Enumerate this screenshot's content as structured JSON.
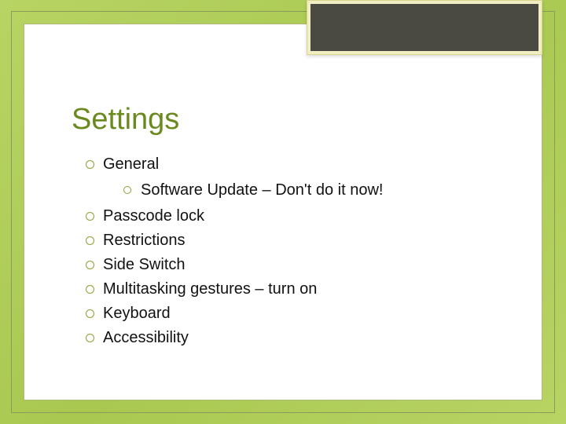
{
  "slide": {
    "title": "Settings",
    "items": [
      {
        "label": "General",
        "sub": [
          {
            "label": "Software Update – Don't do it now!"
          }
        ]
      },
      {
        "label": "Passcode lock"
      },
      {
        "label": "Restrictions"
      },
      {
        "label": "Side Switch"
      },
      {
        "label": "Multitasking gestures – turn on"
      },
      {
        "label": "Keyboard"
      },
      {
        "label": "Accessibility"
      }
    ]
  },
  "theme": {
    "accent": "#6a8a1f",
    "bullet_ring": "#8fa032",
    "dark_box": "#4a4a42"
  }
}
